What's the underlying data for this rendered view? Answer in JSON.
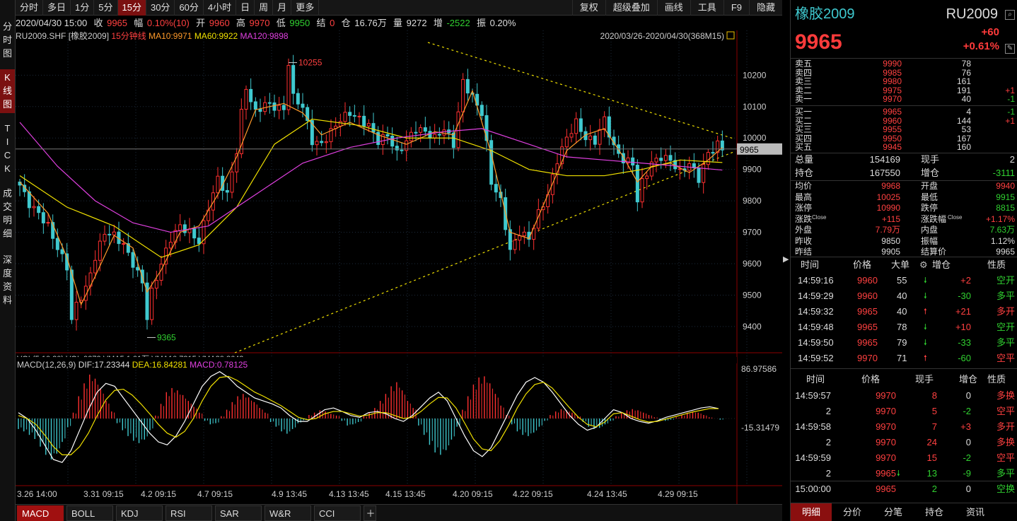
{
  "toolbar": {
    "periods": [
      "分时",
      "多日",
      "1分",
      "5分",
      "15分",
      "30分",
      "60分",
      "4小时",
      "日",
      "周",
      "月",
      "更多"
    ],
    "active_period": "15分",
    "right": [
      "复权",
      "超级叠加",
      "画线",
      "工具",
      "F9",
      "隐藏"
    ]
  },
  "leftnav": {
    "items": [
      "分时图",
      "K线图",
      "TICK",
      "成交明细",
      "深度资料"
    ]
  },
  "infobar": {
    "date": "2020/04/30 15:00",
    "close_label": "收",
    "close": "9965",
    "amp_label": "幅",
    "amp": "0.10%(10)",
    "open_label": "开",
    "open": "9960",
    "high_label": "高",
    "high": "9970",
    "low_label": "低",
    "low": "9950",
    "settle_label": "结",
    "settle": "0",
    "oi_label": "仓",
    "oi": "16.76万",
    "vol_label": "量",
    "vol": "9272",
    "inc_label": "增",
    "inc": "-2522",
    "osc_label": "振",
    "osc": "0.20%"
  },
  "chart": {
    "symbol": "RU2009.SHF [橡胶2009]",
    "period_label": "15分钟线",
    "ma10": "MA10:9971",
    "ma60": "MA60:9922",
    "ma120": "MA120:9898",
    "range": "2020/03/26-2020/04/30(368M15)",
    "max_label": "10255",
    "min_label": "9365",
    "last_price_tag": "9965",
    "macd_title": "MACD(12,26,9)",
    "dif": "DIF:17.23344",
    "dea": "DEA:16.84281",
    "macd": "MACD:0.78125",
    "macd_top": "86.97586",
    "macd_mid": "-15.31479",
    "vol_line_fragment": "VOL(5,10,20)  VOL:9272  VMA5:1.01万  VMA10:7315  VMA20:8643"
  },
  "chart_data": {
    "type": "candlestick",
    "y_ticks": [
      10200,
      10100,
      10000,
      9900,
      9800,
      9700,
      9600,
      9500,
      9400
    ],
    "x_labels": [
      "3.26 14:00",
      "3.31 09:15",
      "4.2 09:15",
      "4.7 09:15",
      "4.9 13:45",
      "4.13 13:45",
      "4.15 13:45",
      "4.20 09:15",
      "4.22 09:15",
      "4.24 13:45",
      "4.29 09:15"
    ],
    "ylim": [
      9330,
      10320
    ],
    "close_path": [
      [
        0,
        9850
      ],
      [
        2,
        9790
      ],
      [
        4,
        9760
      ],
      [
        6,
        9720
      ],
      [
        8,
        9650
      ],
      [
        10,
        9590
      ],
      [
        11,
        9420
      ],
      [
        12,
        9470
      ],
      [
        14,
        9520
      ],
      [
        16,
        9620
      ],
      [
        18,
        9700
      ],
      [
        20,
        9690
      ],
      [
        22,
        9660
      ],
      [
        24,
        9600
      ],
      [
        26,
        9540
      ],
      [
        27,
        9430
      ],
      [
        28,
        9510
      ],
      [
        30,
        9600
      ],
      [
        32,
        9680
      ],
      [
        34,
        9720
      ],
      [
        36,
        9700
      ],
      [
        38,
        9670
      ],
      [
        40,
        9780
      ],
      [
        42,
        9870
      ],
      [
        44,
        9820
      ],
      [
        46,
        9960
      ],
      [
        47,
        10080
      ],
      [
        48,
        10160
      ],
      [
        50,
        10080
      ],
      [
        52,
        10110
      ],
      [
        54,
        10100
      ],
      [
        56,
        10090
      ],
      [
        57,
        10240
      ],
      [
        58,
        10130
      ],
      [
        60,
        10100
      ],
      [
        62,
        9990
      ],
      [
        64,
        9980
      ],
      [
        66,
        10020
      ],
      [
        68,
        10060
      ],
      [
        70,
        10080
      ],
      [
        72,
        10060
      ],
      [
        74,
        10040
      ],
      [
        76,
        9990
      ],
      [
        78,
        10010
      ],
      [
        80,
        9950
      ],
      [
        82,
        9990
      ],
      [
        84,
        10030
      ],
      [
        86,
        10020
      ],
      [
        88,
        10000
      ],
      [
        90,
        10030
      ],
      [
        92,
        9980
      ],
      [
        94,
        10180
      ],
      [
        96,
        10130
      ],
      [
        98,
        10080
      ],
      [
        99,
        9980
      ],
      [
        100,
        9860
      ],
      [
        102,
        9800
      ],
      [
        104,
        9640
      ],
      [
        106,
        9700
      ],
      [
        108,
        9680
      ],
      [
        110,
        9760
      ],
      [
        112,
        9820
      ],
      [
        114,
        9930
      ],
      [
        116,
        10000
      ],
      [
        118,
        10050
      ],
      [
        120,
        10000
      ],
      [
        122,
        9990
      ],
      [
        124,
        10060
      ],
      [
        126,
        9970
      ],
      [
        128,
        9930
      ],
      [
        130,
        9920
      ],
      [
        131,
        9800
      ],
      [
        132,
        9860
      ],
      [
        134,
        9920
      ],
      [
        136,
        9940
      ],
      [
        138,
        9930
      ],
      [
        140,
        9890
      ],
      [
        142,
        9920
      ],
      [
        144,
        9870
      ],
      [
        146,
        9950
      ],
      [
        148,
        9980
      ],
      [
        149,
        9965
      ]
    ],
    "ma_series": [
      {
        "name": "MA10",
        "color": "#ff9a2a",
        "values": [
          [
            0,
            9860
          ],
          [
            6,
            9760
          ],
          [
            10,
            9620
          ],
          [
            13,
            9470
          ],
          [
            16,
            9560
          ],
          [
            20,
            9690
          ],
          [
            24,
            9650
          ],
          [
            27,
            9510
          ],
          [
            30,
            9580
          ],
          [
            34,
            9700
          ],
          [
            38,
            9720
          ],
          [
            42,
            9820
          ],
          [
            46,
            9940
          ],
          [
            50,
            10090
          ],
          [
            56,
            10110
          ],
          [
            60,
            10080
          ],
          [
            64,
            10010
          ],
          [
            70,
            10050
          ],
          [
            76,
            10010
          ],
          [
            82,
            9980
          ],
          [
            88,
            10020
          ],
          [
            92,
            10010
          ],
          [
            96,
            10150
          ],
          [
            100,
            9950
          ],
          [
            104,
            9700
          ],
          [
            108,
            9680
          ],
          [
            112,
            9820
          ],
          [
            116,
            9960
          ],
          [
            120,
            10010
          ],
          [
            124,
            10030
          ],
          [
            128,
            9940
          ],
          [
            131,
            9860
          ],
          [
            134,
            9910
          ],
          [
            138,
            9920
          ],
          [
            142,
            9890
          ],
          [
            146,
            9930
          ],
          [
            149,
            9970
          ]
        ]
      },
      {
        "name": "MA60",
        "color": "#f0e000",
        "values": [
          [
            0,
            9880
          ],
          [
            10,
            9780
          ],
          [
            20,
            9720
          ],
          [
            30,
            9620
          ],
          [
            38,
            9660
          ],
          [
            46,
            9780
          ],
          [
            54,
            9980
          ],
          [
            62,
            10060
          ],
          [
            72,
            10040
          ],
          [
            82,
            10000
          ],
          [
            92,
            10000
          ],
          [
            100,
            9960
          ],
          [
            108,
            9900
          ],
          [
            116,
            9880
          ],
          [
            124,
            9880
          ],
          [
            132,
            9900
          ],
          [
            140,
            9930
          ],
          [
            149,
            9922
          ]
        ]
      },
      {
        "name": "MA120",
        "color": "#e040e0",
        "values": [
          [
            0,
            10050
          ],
          [
            8,
            9910
          ],
          [
            16,
            9800
          ],
          [
            24,
            9730
          ],
          [
            32,
            9700
          ],
          [
            40,
            9720
          ],
          [
            50,
            9820
          ],
          [
            60,
            9920
          ],
          [
            70,
            9970
          ],
          [
            80,
            10000
          ],
          [
            90,
            10020
          ],
          [
            98,
            10030
          ],
          [
            108,
            9980
          ],
          [
            116,
            9940
          ],
          [
            124,
            9930
          ],
          [
            132,
            9920
          ],
          [
            140,
            9910
          ],
          [
            149,
            9898
          ]
        ]
      }
    ],
    "macd": {
      "ylim": [
        -100,
        110
      ],
      "top": 86.97586,
      "bottom": -15.31479,
      "bars": [
        -18,
        -22,
        -28,
        -35,
        -48,
        -62,
        -70,
        -60,
        -40,
        -15,
        10,
        38,
        60,
        75,
        68,
        50,
        30,
        12,
        -8,
        -20,
        -30,
        -38,
        -42,
        -36,
        -20,
        5,
        25,
        45,
        52,
        48,
        40,
        30,
        20,
        10,
        -4,
        -10,
        -8,
        4,
        15,
        28,
        38,
        42,
        36,
        28,
        18,
        10,
        -6,
        -14,
        -22,
        -26,
        -18,
        -8,
        -3,
        6,
        10,
        14,
        12,
        8,
        5,
        -4,
        -12,
        -10,
        -6,
        4,
        10,
        18,
        30,
        42,
        55,
        62,
        48,
        30,
        18,
        -12,
        -28,
        -45,
        -58,
        -62,
        -54,
        -36,
        -14,
        15,
        38,
        58,
        70,
        72,
        60,
        42,
        22,
        6,
        -10,
        -22,
        -28,
        -30,
        -24,
        -14,
        -4,
        6,
        12,
        16,
        14,
        10,
        4,
        -6,
        -14,
        -18,
        -16,
        -10,
        -4,
        4,
        10,
        14,
        16,
        14,
        10,
        6,
        2,
        -2,
        -4,
        -2,
        2,
        6,
        10,
        12,
        10,
        6,
        2,
        0,
        -2
      ],
      "dif": [
        10,
        0,
        -20,
        -45,
        -70,
        -75,
        -55,
        -20,
        15,
        45,
        60,
        55,
        35,
        15,
        -5,
        -25,
        -40,
        -45,
        -30,
        -5,
        25,
        55,
        72,
        80,
        70,
        55,
        45,
        35,
        30,
        25,
        18,
        5,
        -5,
        -5,
        5,
        15,
        18,
        12,
        5,
        2,
        10,
        12,
        8,
        0,
        -5,
        5,
        20,
        35,
        45,
        30,
        0,
        -30,
        -55,
        -65,
        -50,
        -20,
        10,
        40,
        62,
        70,
        62,
        45,
        25,
        5,
        -10,
        -20,
        -15,
        0,
        15,
        10,
        0,
        -5,
        -8,
        -4,
        2,
        6,
        10,
        14,
        18,
        20,
        17
      ],
      "dea": [
        5,
        0,
        -10,
        -28,
        -48,
        -62,
        -62,
        -48,
        -25,
        5,
        32,
        48,
        50,
        40,
        25,
        8,
        -10,
        -25,
        -32,
        -22,
        0,
        30,
        55,
        70,
        72,
        65,
        55,
        45,
        38,
        30,
        22,
        12,
        2,
        -2,
        0,
        8,
        12,
        12,
        8,
        4,
        6,
        10,
        10,
        5,
        0,
        2,
        12,
        25,
        36,
        35,
        18,
        -8,
        -35,
        -52,
        -55,
        -38,
        -12,
        18,
        42,
        58,
        62,
        52,
        35,
        18,
        2,
        -10,
        -14,
        -6,
        8,
        10,
        4,
        -2,
        -6,
        -5,
        -1,
        3,
        7,
        11,
        14,
        17,
        16.8
      ]
    }
  },
  "bottom_tabs": [
    "MACD",
    "BOLL",
    "KDJ",
    "RSI",
    "SAR",
    "W&R",
    "CCI"
  ],
  "right_panel": {
    "name": "橡胶2009",
    "code": "RU2009",
    "price": "9965",
    "change": "+60",
    "change_pct": "+0.61%",
    "asks": [
      {
        "label": "卖五",
        "price": "9990",
        "vol": "78",
        "chg": ""
      },
      {
        "label": "卖四",
        "price": "9985",
        "vol": "76",
        "chg": ""
      },
      {
        "label": "卖三",
        "price": "9980",
        "vol": "161",
        "chg": ""
      },
      {
        "label": "卖二",
        "price": "9975",
        "vol": "191",
        "chg": "+1"
      },
      {
        "label": "卖一",
        "price": "9970",
        "vol": "40",
        "chg": "-1"
      }
    ],
    "bids": [
      {
        "label": "买一",
        "price": "9965",
        "vol": "4",
        "chg": "-1"
      },
      {
        "label": "买二",
        "price": "9960",
        "vol": "144",
        "chg": "+1"
      },
      {
        "label": "买三",
        "price": "9955",
        "vol": "53",
        "chg": ""
      },
      {
        "label": "买四",
        "price": "9950",
        "vol": "167",
        "chg": ""
      },
      {
        "label": "买五",
        "price": "9945",
        "vol": "160",
        "chg": ""
      }
    ],
    "stats1": [
      {
        "l": "总量",
        "v": "154169",
        "l2": "现手",
        "v2": "2"
      },
      {
        "l": "持仓",
        "v": "167550",
        "l2": "增仓",
        "v2": "-3111"
      }
    ],
    "stats2": [
      {
        "l": "均价",
        "v": "9968",
        "l2": "开盘",
        "v2": "9940"
      },
      {
        "l": "最高",
        "v": "10025",
        "l2": "最低",
        "v2": "9915"
      },
      {
        "l": "涨停",
        "v": "10990",
        "l2": "跌停",
        "v2": "8815"
      },
      {
        "l": "涨跌",
        "sup": "Close",
        "v": "+115",
        "l2": "涨跌幅",
        "sup2": "Close",
        "v2": "+1.17%"
      },
      {
        "l": "外盘",
        "v": "7.79万",
        "l2": "内盘",
        "v2": "7.63万"
      },
      {
        "l": "昨收",
        "v": "9850",
        "l2": "振幅",
        "v2": "1.12%"
      },
      {
        "l": "昨结",
        "v": "9905",
        "l2": "结算价",
        "v2": "9965"
      }
    ],
    "trades_header": [
      "时间",
      "价格",
      "大单",
      "增仓",
      "性质"
    ],
    "trades": [
      {
        "t": "14:59:16",
        "p": "9960",
        "s": "55",
        "dir": "down",
        "oi": "+2",
        "n": "空开"
      },
      {
        "t": "14:59:29",
        "p": "9960",
        "s": "40",
        "dir": "down",
        "oi": "-30",
        "n": "多平"
      },
      {
        "t": "14:59:32",
        "p": "9965",
        "s": "40",
        "dir": "up",
        "oi": "+21",
        "n": "多开"
      },
      {
        "t": "14:59:48",
        "p": "9965",
        "s": "78",
        "dir": "down",
        "oi": "+10",
        "n": "空开"
      },
      {
        "t": "14:59:50",
        "p": "9965",
        "s": "79",
        "dir": "down",
        "oi": "-33",
        "n": "多平"
      },
      {
        "t": "14:59:52",
        "p": "9970",
        "s": "71",
        "dir": "up",
        "oi": "-60",
        "n": "空平"
      }
    ],
    "ticks_header": [
      "时间",
      "价格",
      "现手",
      "增仓",
      "性质"
    ],
    "ticks": [
      {
        "t": "14:59:57",
        "p": "9970",
        "s": "8",
        "oi": "0",
        "n": "多换"
      },
      {
        "t": "2",
        "p": "9970",
        "s": "5",
        "oi": "-2",
        "n": "空平"
      },
      {
        "t": "14:59:58",
        "p": "9970",
        "s": "7",
        "oi": "+3",
        "n": "多开"
      },
      {
        "t": "2",
        "p": "9970",
        "s": "24",
        "oi": "0",
        "n": "多换"
      },
      {
        "t": "14:59:59",
        "p": "9970",
        "s": "15",
        "oi": "-2",
        "n": "空平"
      },
      {
        "t": "2",
        "p": "9965",
        "s": "13",
        "oi": "-9",
        "n": "多平",
        "arrow": "down"
      },
      {
        "t": "15:00:00",
        "p": "9965",
        "s": "2",
        "oi": "0",
        "n": "空换"
      }
    ],
    "tabs": [
      "明细",
      "分价",
      "分笔",
      "持仓",
      "资讯"
    ]
  }
}
